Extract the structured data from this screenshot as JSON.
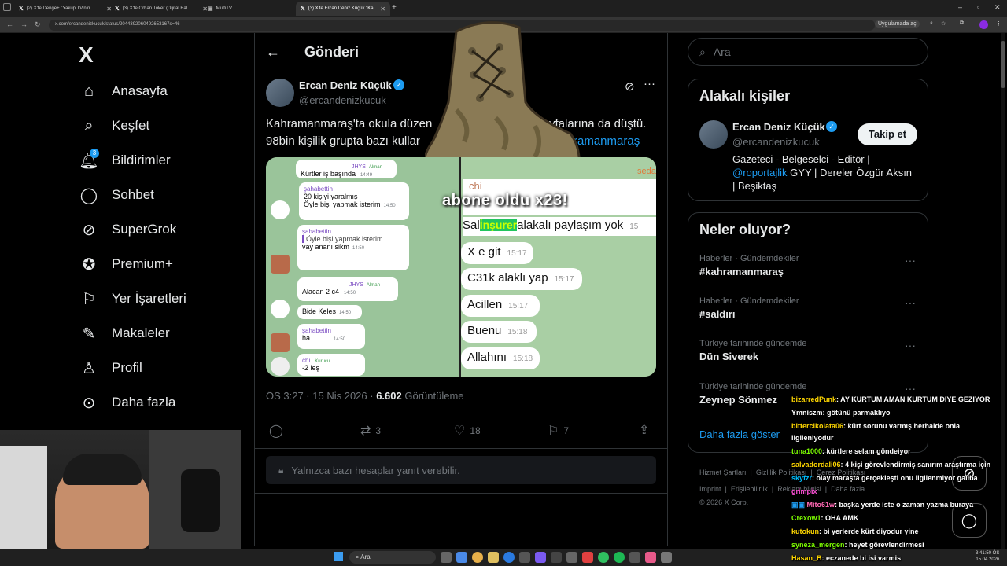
{
  "browser": {
    "tabs": [
      {
        "label": "(2) X'te Denge+ \"Yakup TV'nin",
        "active": false
      },
      {
        "label": "(3) X'te Orhan Toker (Dijital Bal",
        "active": false
      },
      {
        "label": "MultiTV",
        "active": false
      },
      {
        "label": "(3) X'te Ercan Deniz Küçük \"Ka",
        "active": true
      }
    ],
    "new_tab": "+",
    "url": "x.com/ercandenizkucuk/status/2044392060492653167s=46",
    "apps_label": "Uygulamada aç"
  },
  "nav": {
    "logo": "X",
    "items": [
      {
        "label": "Anasayfa",
        "icon": "home-icon"
      },
      {
        "label": "Keşfet",
        "icon": "search-icon"
      },
      {
        "label": "Bildirimler",
        "icon": "bell-icon"
      },
      {
        "label": "Sohbet",
        "icon": "chat-icon"
      },
      {
        "label": "SuperGrok",
        "icon": "grok-icon"
      },
      {
        "label": "Premium+",
        "icon": "verified-icon"
      },
      {
        "label": "Yer İşaretleri",
        "icon": "bookmark-icon"
      },
      {
        "label": "Makaleler",
        "icon": "article-icon"
      },
      {
        "label": "Profil",
        "icon": "user-icon"
      },
      {
        "label": "Daha fazla",
        "icon": "more-icon"
      }
    ],
    "notif_count": "3"
  },
  "post": {
    "header": "Gönderi",
    "author_name": "Ercan Deniz Küçük",
    "author_handle": "@ercandenizkucuk",
    "text_line1": "Kahramanmaraş'ta okula düzen",
    "text_line1b": "K sayfalarına da düştü.",
    "text_line2": "98bin kişilik grupta bazı kullar",
    "hashtag": "ramanmaraş",
    "meta_time": "ÖS 3:27 · 15 Nis 2026 · ",
    "views": "6.602",
    "views_label": "Görüntüleme",
    "retweets": "3",
    "likes": "18",
    "bookmarks": "7",
    "reply_notice": "Yalnızca bazı hesaplar yanıt verebilir.",
    "overlay_text": "abone oldu x23!"
  },
  "left_chat": [
    {
      "name": "JHYS",
      "role": "Alman",
      "text": "Kürtler iş başında",
      "time": "14:49"
    },
    {
      "name": "şahabettin",
      "text": "20 kişiyi yaralmış",
      "time": ""
    },
    {
      "name": "",
      "text": "Öyle bişi yapmak isterim",
      "time": "14:50"
    },
    {
      "name": "şahabettin",
      "text": "Öyle bişi yapmak isterim",
      "time": ""
    },
    {
      "name": "",
      "text": "vay ananı sikm",
      "time": "14:50"
    },
    {
      "name": "JHYS",
      "role": "Alman",
      "text": "Alacan 2 c4",
      "time": "14:50"
    },
    {
      "name": "",
      "text": "Bide Keles",
      "time": "14:50"
    },
    {
      "name": "şahabettin",
      "text": "ha",
      "time": "14:50"
    },
    {
      "name": "chi",
      "role": "Kurucu",
      "text": "-2 leş",
      "time": "14:50"
    }
  ],
  "right_chat": [
    {
      "text": "Sal",
      "text2": "alakalı paylaşım yok",
      "highlight": "İnşurer",
      "time": "15"
    },
    {
      "text": "X e git",
      "time": "15:17"
    },
    {
      "text": "C31k alaklı yap",
      "time": "15:17"
    },
    {
      "text": "Acillen",
      "time": "15:17"
    },
    {
      "text": "Buenu",
      "time": "15:18"
    },
    {
      "text": "Allahını",
      "time": "15:18"
    }
  ],
  "right_chat_header": "chi",
  "right_chat_corner": "seda",
  "sidebar": {
    "search_placeholder": "Ara",
    "related_title": "Alakalı kişiler",
    "person_name": "Ercan Deniz Küçük",
    "person_handle": "@ercandenizkucuk",
    "follow_label": "Takip et",
    "bio1": "Gazeteci - Belgeselci - Editör |",
    "bio_link": "@roportajlik",
    "bio2": " GYY | Dereler Özgür Aksın",
    "bio3": "| Beşiktaş",
    "trends_title": "Neler oluyor?",
    "trends": [
      {
        "meta": "Haberler · Gündemdekiler",
        "name": "#kahramanmaraş"
      },
      {
        "meta": "Haberler · Gündemdekiler",
        "name": "#saldırı"
      },
      {
        "meta": "Türkiye tarihinde gündemde",
        "name": "Dün Siverek"
      },
      {
        "meta": "Türkiye tarihinde gündemde",
        "name": "Zeynep Sönmez"
      }
    ],
    "show_more": "Daha fazla göster",
    "footer1": "Hizmet Şartları",
    "footer2": "Gizlilik Politikası",
    "footer3": "Çerez Politikası",
    "footer4": "Imprint",
    "footer5": "Erişilebilirlik",
    "footer6": "Reklam bilgisi",
    "footer7": "Daha fazla ...",
    "copyright": "© 2026 X Corp."
  },
  "stream_chat": [
    {
      "user": "bizarredPunk",
      "msg": ": AY KURTUM AMAN KURTUM DIYE GEZIYOR",
      "color": "#ffd700"
    },
    {
      "user": "Ymniszm",
      "msg": ": götünü parmaklıyo",
      "color": "#ffffff"
    },
    {
      "user": "bittercikolata06",
      "msg": ": kürt sorunu varmış herhalde onla",
      "color": "#ffd700"
    },
    {
      "user": "",
      "msg": "ilgileniyodur",
      "color": "#ffffff"
    },
    {
      "user": "tuna1000",
      "msg": ": kürtlere selam göndeiyor",
      "color": "#7cfc00"
    },
    {
      "user": "salvadordali06",
      "msg": ": 4 kişi görevlendirmiş sanırım araştırma için",
      "color": "#ffd700"
    },
    {
      "user": "skyfzr",
      "msg": ": olay maraşta gerçekleşti onu ilgilenmiyor galiba",
      "color": "#00bfff"
    },
    {
      "user": "grimpix",
      "msg": "",
      "color": "#ff4fd8"
    },
    {
      "user": "Mito61w",
      "msg": ": başka yerde iste o zaman yazma buraya",
      "color": "#ff69b4"
    },
    {
      "user": "Crexow1",
      "msg": ": OHA AMK",
      "color": "#7cfc00"
    },
    {
      "user": "kutokun",
      "msg": ": bi yerlerde kürt diyodur yine",
      "color": "#ffd700"
    },
    {
      "user": "syneza_mergen",
      "msg": ": heyet görevlendirmesi",
      "color": "#7cfc00"
    },
    {
      "user": "Hasan_B",
      "msg": ": eczanede bi isi varmis",
      "color": "#ffd700"
    }
  ],
  "taskbar": {
    "search": "Ara",
    "time": "3:41:50 ÖS",
    "date": "15.04.2026"
  },
  "colors": {
    "accent": "#1d9bf0",
    "bg": "#000000",
    "muted": "#71767b",
    "border": "#2f3336"
  }
}
